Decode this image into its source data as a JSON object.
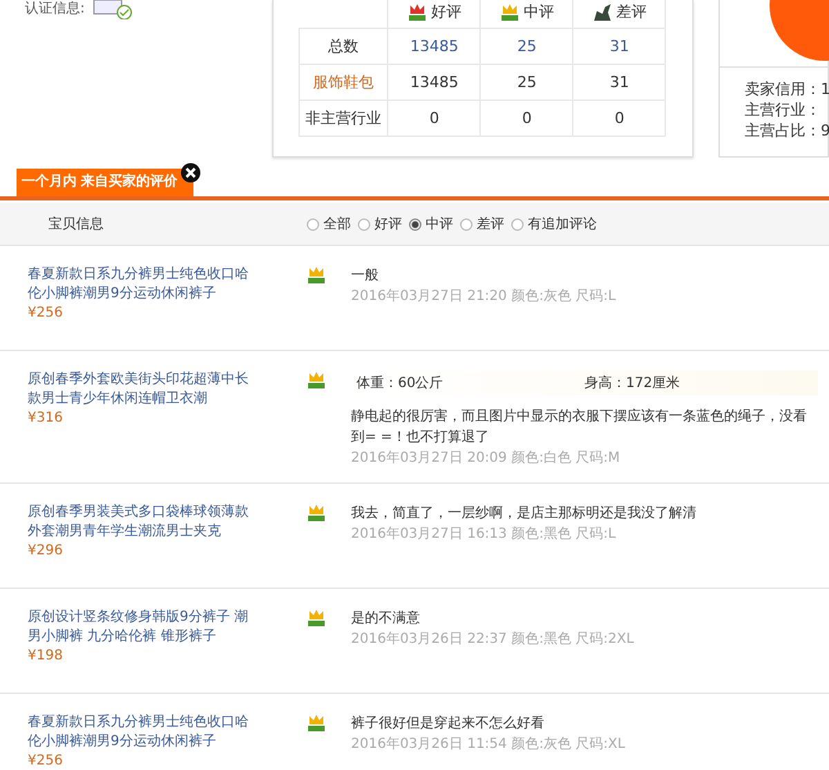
{
  "seller": {
    "label": "认证信息:"
  },
  "stats": {
    "headers": [
      {
        "label": "好评",
        "kind": "good"
      },
      {
        "label": "中评",
        "kind": "neutral"
      },
      {
        "label": "差评",
        "kind": "bad"
      }
    ],
    "rows": [
      {
        "label": "总数",
        "kind": "total",
        "values": [
          "13485",
          "25",
          "31"
        ]
      },
      {
        "label": "服饰鞋包",
        "kind": "main",
        "values": [
          "13485",
          "25",
          "31"
        ]
      },
      {
        "label": "非主营行业",
        "kind": "other",
        "values": [
          "0",
          "0",
          "0"
        ]
      }
    ]
  },
  "seller_info": [
    "卖家信用：1",
    "主营行业：",
    "主营占比：9"
  ],
  "tab": {
    "label": "一个月内 来自买家的评价"
  },
  "header": {
    "label": "宝贝信息"
  },
  "filters": [
    {
      "label": "全部",
      "selected": false
    },
    {
      "label": "好评",
      "selected": false
    },
    {
      "label": "中评",
      "selected": true
    },
    {
      "label": "差评",
      "selected": false
    },
    {
      "label": "有追加评论",
      "selected": false
    }
  ],
  "reviews": [
    {
      "product": "春夏新款日系九分裤男士纯色收口哈伦小脚裤潮男9分运动休闲裤子",
      "price": "¥256",
      "comment": "一般",
      "meta": "2016年03月27日 21:20 颜色:灰色   尺码:L"
    },
    {
      "product": "原创春季外套欧美街头印花超薄中长款男士青少年休闲连帽卫衣潮",
      "price": "¥316",
      "body_stats": [
        "体重：60公斤",
        "身高：172厘米"
      ],
      "comment": "静电起的很厉害，而且图片中显示的衣服下摆应该有一条蓝色的绳子，没看到= =！也不打算退了",
      "meta": "2016年03月27日 20:09 颜色:白色   尺码:M"
    },
    {
      "product": "原创春季男装美式多口袋棒球领薄款外套潮男青年学生潮流男士夹克",
      "price": "¥296",
      "comment": "我去，简直了，一层纱啊，是店主那标明还是我没了解清",
      "meta": "2016年03月27日 16:13 颜色:黑色   尺码:L"
    },
    {
      "product": "原创设计竖条纹修身韩版9分裤子 潮男小脚裤 九分哈伦裤 锥形裤子",
      "price": "¥198",
      "comment": "是的不满意",
      "meta": "2016年03月26日 22:37 颜色:黑色   尺码:2XL"
    },
    {
      "product": "春夏新款日系九分裤男士纯色收口哈伦小脚裤潮男9分运动休闲裤子",
      "price": "¥256",
      "comment": "裤子很好但是穿起来不怎么好看",
      "meta": "2016年03月26日 11:54 颜色:灰色   尺码:XL"
    }
  ]
}
